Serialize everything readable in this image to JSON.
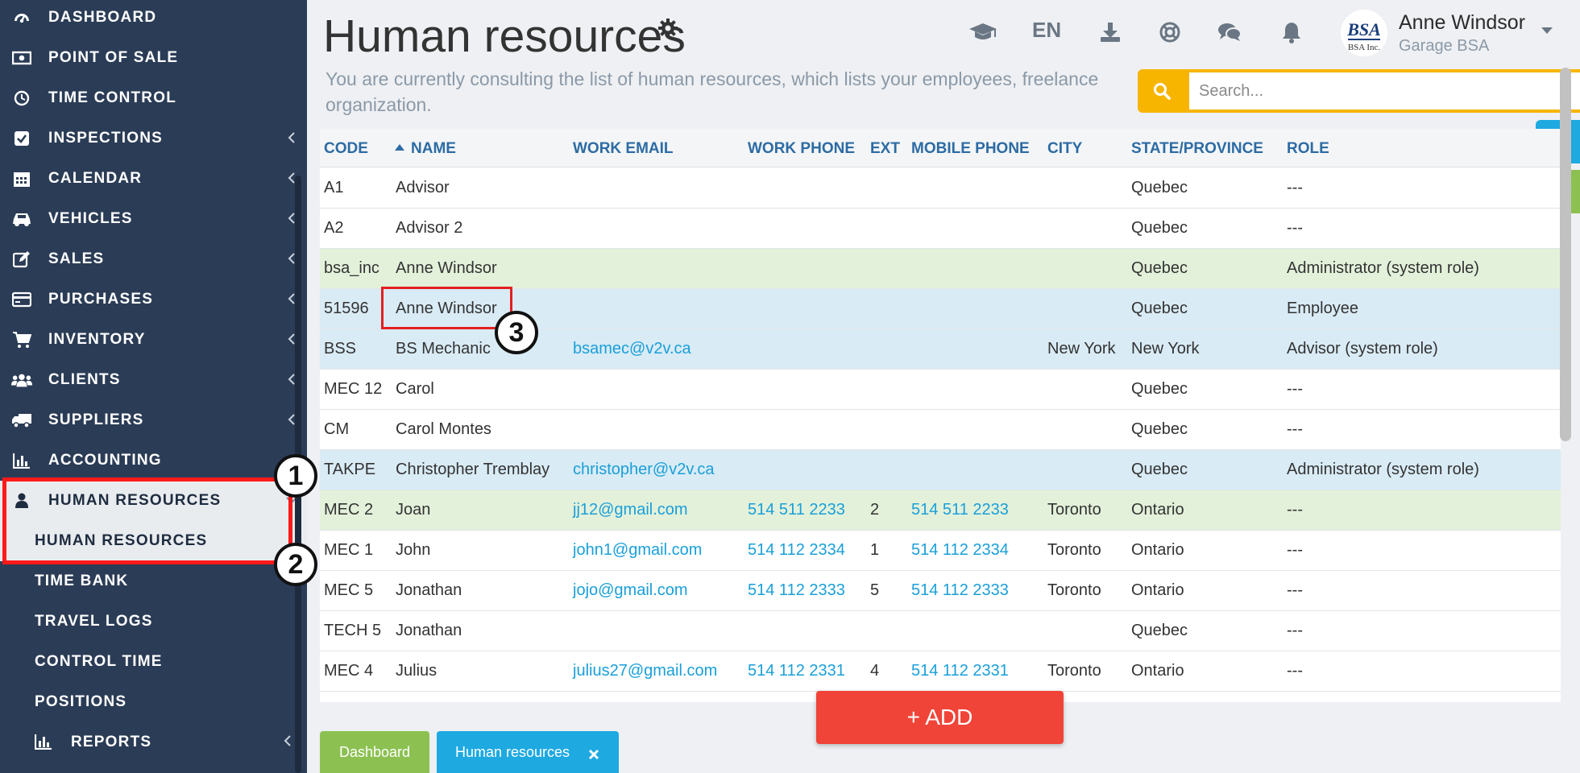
{
  "sidebar": {
    "items": [
      {
        "label": "DASHBOARD",
        "icon": "dashboard-icon"
      },
      {
        "label": "POINT OF SALE",
        "icon": "money-icon"
      },
      {
        "label": "TIME CONTROL",
        "icon": "clock-icon"
      },
      {
        "label": "INSPECTIONS",
        "icon": "checkbox-icon"
      },
      {
        "label": "CALENDAR",
        "icon": "calendar-icon"
      },
      {
        "label": "VEHICLES",
        "icon": "car-icon"
      },
      {
        "label": "SALES",
        "icon": "edit-icon"
      },
      {
        "label": "PURCHASES",
        "icon": "credit-card-icon"
      },
      {
        "label": "INVENTORY",
        "icon": "cart-icon"
      },
      {
        "label": "CLIENTS",
        "icon": "users-icon"
      },
      {
        "label": "SUPPLIERS",
        "icon": "truck-icon"
      },
      {
        "label": "ACCOUNTING",
        "icon": "bar-chart-icon"
      },
      {
        "label": "HUMAN RESOURCES",
        "icon": "user-icon"
      }
    ],
    "subitems": [
      {
        "label": "HUMAN RESOURCES"
      },
      {
        "label": "TIME BANK"
      },
      {
        "label": "TRAVEL LOGS"
      },
      {
        "label": "CONTROL TIME"
      },
      {
        "label": "POSITIONS"
      },
      {
        "label": "REPORTS"
      }
    ]
  },
  "header": {
    "title": "Human resources",
    "description": "You are currently consulting the list of human resources, which lists your employees, freelance organization.",
    "language": "EN",
    "user_name": "Anne Windsor",
    "user_org": "Garage BSA",
    "avatar_text": "BSA",
    "avatar_subtext": "BSA Inc."
  },
  "search": {
    "placeholder": "Search..."
  },
  "table": {
    "columns": [
      "CODE",
      "NAME",
      "WORK EMAIL",
      "WORK PHONE",
      "EXT",
      "MOBILE PHONE",
      "CITY",
      "STATE/PROVINCE",
      "ROLE"
    ],
    "rows": [
      {
        "code": "A1",
        "name": "Advisor",
        "email": "",
        "phone": "",
        "ext": "",
        "mobile": "",
        "city": "",
        "state": "Quebec",
        "role": "---",
        "bg": "#ffffff"
      },
      {
        "code": "A2",
        "name": "Advisor 2",
        "email": "",
        "phone": "",
        "ext": "",
        "mobile": "",
        "city": "",
        "state": "Quebec",
        "role": "---",
        "bg": "#ffffff"
      },
      {
        "code": "bsa_inc",
        "name": "Anne Windsor",
        "email": "",
        "phone": "",
        "ext": "",
        "mobile": "",
        "city": "",
        "state": "Quebec",
        "role": "Administrator (system role)",
        "bg": "#e3f1da"
      },
      {
        "code": "51596",
        "name": "Anne Windsor",
        "email": "",
        "phone": "",
        "ext": "",
        "mobile": "",
        "city": "",
        "state": "Quebec",
        "role": "Employee",
        "bg": "#d9ebf5"
      },
      {
        "code": "BSS",
        "name": "BS Mechanic",
        "email": "bsamec@v2v.ca",
        "phone": "",
        "ext": "",
        "mobile": "",
        "city": "New York",
        "state": "New York",
        "role": "Advisor (system role)",
        "bg": "#d9ebf5"
      },
      {
        "code": "MEC 12",
        "name": "Carol",
        "email": "",
        "phone": "",
        "ext": "",
        "mobile": "",
        "city": "",
        "state": "Quebec",
        "role": "---",
        "bg": "#ffffff"
      },
      {
        "code": "CM",
        "name": "Carol Montes",
        "email": "",
        "phone": "",
        "ext": "",
        "mobile": "",
        "city": "",
        "state": "Quebec",
        "role": "---",
        "bg": "#ffffff"
      },
      {
        "code": "TAKPE",
        "name": "Christopher Tremblay",
        "email": "christopher@v2v.ca",
        "phone": "",
        "ext": "",
        "mobile": "",
        "city": "",
        "state": "Quebec",
        "role": "Administrator (system role)",
        "bg": "#d9ebf5"
      },
      {
        "code": "MEC 2",
        "name": "Joan",
        "email": "jj12@gmail.com",
        "phone": "514 511 2233",
        "ext": "2",
        "mobile": "514 511 2233",
        "city": "Toronto",
        "state": "Ontario",
        "role": "---",
        "bg": "#e3f1da"
      },
      {
        "code": "MEC 1",
        "name": "John",
        "email": "john1@gmail.com",
        "phone": "514 112 2334",
        "ext": "1",
        "mobile": "514 112 2334",
        "city": "Toronto",
        "state": "Ontario",
        "role": "---",
        "bg": "#ffffff"
      },
      {
        "code": "MEC 5",
        "name": "Jonathan",
        "email": "jojo@gmail.com",
        "phone": "514 112 2333",
        "ext": "5",
        "mobile": "514 112 2333",
        "city": "Toronto",
        "state": "Ontario",
        "role": "---",
        "bg": "#ffffff"
      },
      {
        "code": "TECH 5",
        "name": "Jonathan",
        "email": "",
        "phone": "",
        "ext": "",
        "mobile": "",
        "city": "",
        "state": "Quebec",
        "role": "---",
        "bg": "#ffffff"
      },
      {
        "code": "MEC 4",
        "name": "Julius",
        "email": "julius27@gmail.com",
        "phone": "514 112 2331",
        "ext": "4",
        "mobile": "514 112 2331",
        "city": "Toronto",
        "state": "Ontario",
        "role": "---",
        "bg": "#ffffff"
      }
    ]
  },
  "add_button": {
    "label": "+ ADD"
  },
  "tabs": [
    {
      "label": "Dashboard"
    },
    {
      "label": "Human resources"
    }
  ],
  "annotations": [
    "1",
    "2",
    "3"
  ],
  "colors": {
    "sidebar_bg": "#2b3c56",
    "link": "#1a9fd9",
    "header_link": "#2d6ba3",
    "search": "#f7b500",
    "add": "#f04438",
    "tab_green": "#8cc152",
    "tab_blue": "#1ea9e1",
    "annotation": "#ff1a1a"
  }
}
